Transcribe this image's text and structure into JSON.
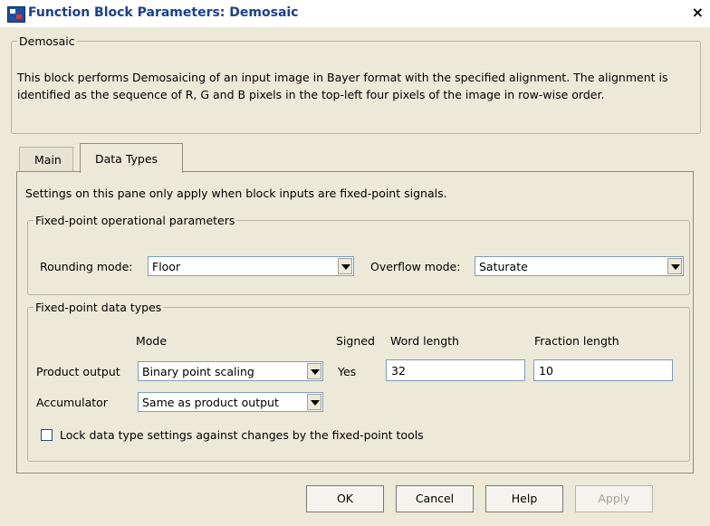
{
  "window": {
    "title": "Function Block Parameters: Demosaic",
    "close_glyph": "×"
  },
  "block": {
    "group_title": "Demosaic",
    "description": "This block performs Demosaicing of an input image in Bayer format with the specified alignment. The alignment is identified as the sequence of R, G and B pixels in the top-left four pixels of the image in row-wise order."
  },
  "tabs": [
    {
      "label": "Main",
      "active": false
    },
    {
      "label": "Data Types",
      "active": true
    }
  ],
  "data_types": {
    "note": "Settings on this pane only apply when block inputs are fixed-point signals.",
    "operational": {
      "group_title": "Fixed-point operational parameters",
      "rounding_label": "Rounding mode:",
      "rounding_value": "Floor",
      "overflow_label": "Overflow mode:",
      "overflow_value": "Saturate"
    },
    "types": {
      "group_title": "Fixed-point data types",
      "headers": {
        "mode": "Mode",
        "signed": "Signed",
        "word_length": "Word length",
        "fraction_length": "Fraction length"
      },
      "product_output": {
        "label": "Product output",
        "mode": "Binary point scaling",
        "signed": "Yes",
        "word_length": "32",
        "fraction_length": "10"
      },
      "accumulator": {
        "label": "Accumulator",
        "mode": "Same as product output"
      }
    },
    "lock_label": "Lock data type settings against changes by the fixed-point tools",
    "lock_checked": false
  },
  "buttons": {
    "ok": "OK",
    "cancel": "Cancel",
    "help": "Help",
    "apply": "Apply"
  }
}
